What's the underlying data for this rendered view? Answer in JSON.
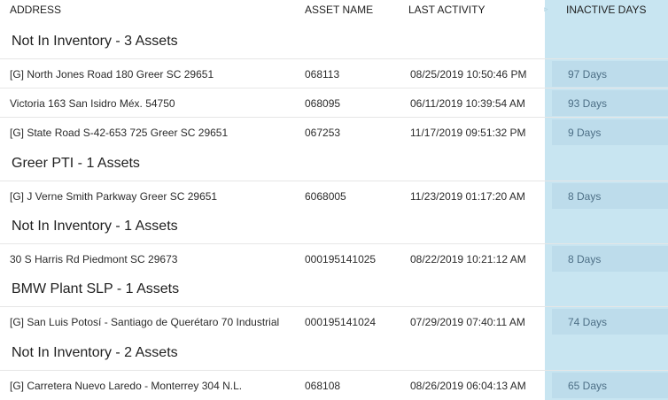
{
  "columns": {
    "address": "ADDRESS",
    "asset_name": "ASSET NAME",
    "last_activity": "LAST ACTIVITY",
    "inactive_days": "INACTIVE DAYS"
  },
  "groups": [
    {
      "title": "Not In Inventory - 3 Assets",
      "rows": [
        {
          "address": "[G] North Jones Road 180 Greer SC 29651",
          "asset_name": "068113",
          "last_activity": "08/25/2019 10:50:46 PM",
          "inactive_days": "97 Days"
        },
        {
          "address": "Victoria 163 San Isidro Méx. 54750",
          "asset_name": "068095",
          "last_activity": "06/11/2019 10:39:54 AM",
          "inactive_days": "93 Days"
        },
        {
          "address": "[G] State Road S-42-653 725 Greer SC 29651",
          "asset_name": "067253",
          "last_activity": "11/17/2019 09:51:32 PM",
          "inactive_days": "9 Days"
        }
      ]
    },
    {
      "title": "Greer PTI - 1 Assets",
      "rows": [
        {
          "address": "[G] J Verne Smith Parkway Greer SC 29651",
          "asset_name": "6068005",
          "last_activity": "11/23/2019 01:17:20 AM",
          "inactive_days": "8 Days"
        }
      ]
    },
    {
      "title": "Not In Inventory - 1 Assets",
      "rows": [
        {
          "address": "30 S Harris Rd Piedmont SC 29673",
          "asset_name": "000195141025",
          "last_activity": "08/22/2019 10:21:12 AM",
          "inactive_days": "8 Days"
        }
      ]
    },
    {
      "title": "BMW Plant SLP - 1 Assets",
      "rows": [
        {
          "address": "[G] San Luis Potosí - Santiago de Querétaro 70 Industrial",
          "asset_name": "000195141024",
          "last_activity": "07/29/2019 07:40:11 AM",
          "inactive_days": "74 Days"
        }
      ]
    },
    {
      "title": "Not In Inventory - 2 Assets",
      "rows": [
        {
          "address": "[G] Carretera Nuevo Laredo - Monterrey 304 N.L.",
          "asset_name": "068108",
          "last_activity": "08/26/2019 06:04:13 AM",
          "inactive_days": "65 Days"
        }
      ]
    }
  ]
}
